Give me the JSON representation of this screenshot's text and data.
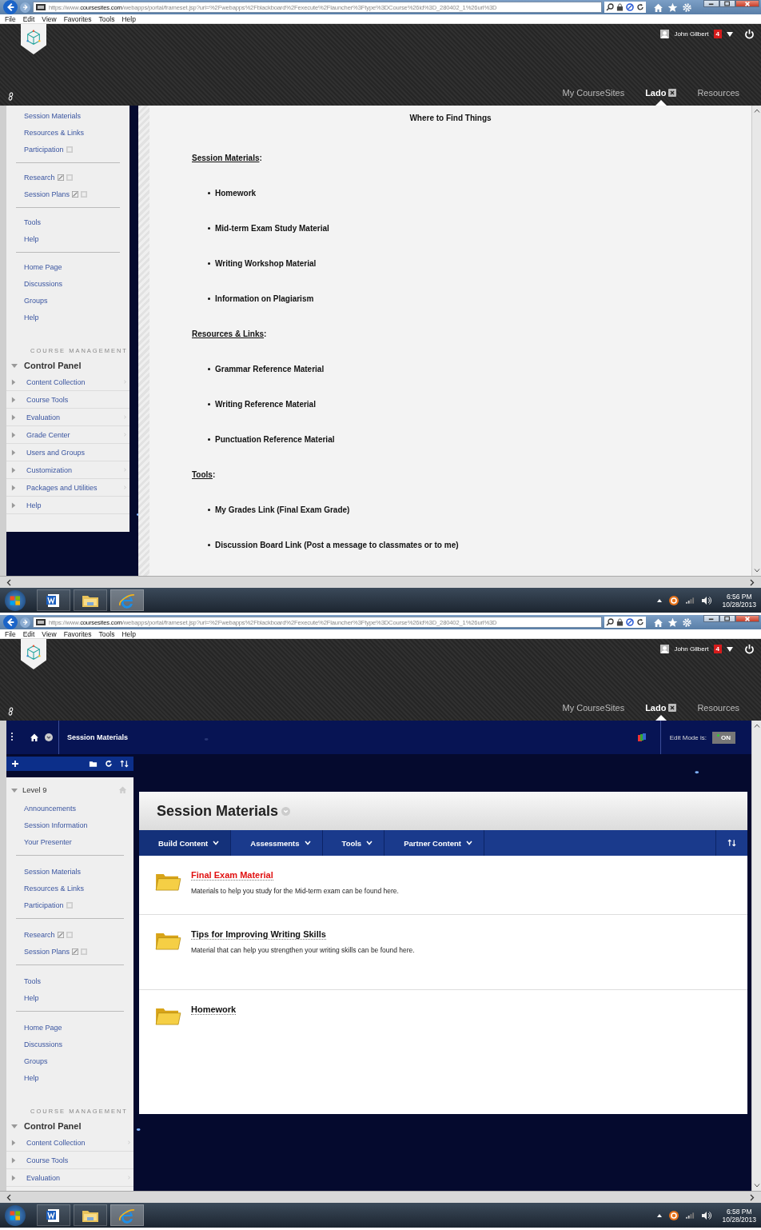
{
  "screens": [
    {
      "kind": "document",
      "browser": {
        "url_scheme": "https://www.",
        "url_domain": "coursesites.com",
        "url_path": "/webapps/portal/frameset.jsp?url=%2Fwebapps%2Fblackboard%2Fexecute%2Flauncher%3Ftype%3DCourse%26id%3D_280402_1%26url%3D",
        "menu": [
          "File",
          "Edit",
          "View",
          "Favorites",
          "Tools",
          "Help"
        ]
      },
      "header": {
        "user": "John Gilbert",
        "notifications": "4",
        "tabs": [
          {
            "label": "My CourseSites",
            "selected": false,
            "closable": false
          },
          {
            "label": "Lado",
            "selected": true,
            "closable": true
          },
          {
            "label": "Resources",
            "selected": false,
            "closable": false
          }
        ]
      },
      "sidebar": {
        "toolbar": false,
        "groups": [
          [
            {
              "label": "Session Materials",
              "external": false,
              "hidden": false
            },
            {
              "label": "Resources & Links",
              "external": false,
              "hidden": false
            },
            {
              "label": "Participation",
              "external": false,
              "hidden": true
            }
          ],
          [
            {
              "label": "Research",
              "external": true,
              "hidden": true
            },
            {
              "label": "Session Plans",
              "external": true,
              "hidden": true
            }
          ],
          [
            {
              "label": "Tools",
              "external": false,
              "hidden": false
            },
            {
              "label": "Help",
              "external": false,
              "hidden": false
            }
          ],
          [
            {
              "label": "Home Page",
              "external": false,
              "hidden": false
            },
            {
              "label": "Discussions",
              "external": false,
              "hidden": false
            },
            {
              "label": "Groups",
              "external": false,
              "hidden": false
            },
            {
              "label": "Help",
              "external": false,
              "hidden": false
            }
          ]
        ],
        "management_label": "COURSE MANAGEMENT",
        "control_panel": {
          "label": "Control Panel",
          "expanded": true,
          "items": [
            {
              "label": "Content Collection",
              "submenu": true
            },
            {
              "label": "Course Tools",
              "submenu": false
            },
            {
              "label": "Evaluation",
              "submenu": true
            },
            {
              "label": "Grade Center",
              "submenu": true
            },
            {
              "label": "Users and Groups",
              "submenu": false
            },
            {
              "label": "Customization",
              "submenu": true
            },
            {
              "label": "Packages and Utilities",
              "submenu": true
            },
            {
              "label": "Help",
              "submenu": false
            }
          ]
        }
      },
      "document": {
        "title": "Where to Find Things",
        "sections": [
          {
            "heading": "Session Materials",
            "punct": ":",
            "items": [
              "Homework",
              "Mid-term Exam Study Material",
              "Writing Workshop Material",
              "Information on Plagiarism"
            ]
          },
          {
            "heading": "Resources & Links",
            "punct": ":",
            "items": [
              "Grammar Reference Material",
              "Writing Reference Material",
              "Punctuation Reference Material"
            ]
          },
          {
            "heading": "Tools",
            "punct": ":",
            "items": [
              "My Grades Link (Final Exam Grade)",
              "Discussion Board Link (Post a message to classmates or to me)"
            ]
          }
        ]
      },
      "taskbar": {
        "apps": [
          {
            "kind": "word",
            "selected": false
          },
          {
            "kind": "explorer",
            "selected": false
          },
          {
            "kind": "ie",
            "selected": true
          }
        ],
        "time": "6:56 PM",
        "date": "10/28/2013"
      }
    },
    {
      "kind": "course_page",
      "browser": {
        "url_scheme": "https://www.",
        "url_domain": "coursesites.com",
        "url_path": "/webapps/portal/frameset.jsp?url=%2Fwebapps%2Fblackboard%2Fexecute%2Flauncher%3Ftype%3DCourse%26id%3D_280402_1%26url%3D",
        "menu": [
          "File",
          "Edit",
          "View",
          "Favorites",
          "Tools",
          "Help"
        ]
      },
      "header": {
        "user": "John Gilbert",
        "notifications": "4",
        "tabs": [
          {
            "label": "My CourseSites",
            "selected": false,
            "closable": false
          },
          {
            "label": "Lado",
            "selected": true,
            "closable": true
          },
          {
            "label": "Resources",
            "selected": false,
            "closable": false
          }
        ]
      },
      "breadcrumb": {
        "label": "Session Materials",
        "edit_mode_label": "Edit Mode is:",
        "edit_mode": {
          "label": "ON",
          "on": true
        }
      },
      "sidebar": {
        "toolbar": true,
        "course": {
          "title": "Level 9",
          "expanded": true
        },
        "groups": [
          [
            {
              "label": "Announcements",
              "external": false,
              "hidden": false
            },
            {
              "label": "Session Information",
              "external": false,
              "hidden": false
            },
            {
              "label": "Your Presenter",
              "external": false,
              "hidden": false
            }
          ],
          [
            {
              "label": "Session Materials",
              "external": false,
              "hidden": false
            },
            {
              "label": "Resources & Links",
              "external": false,
              "hidden": false
            },
            {
              "label": "Participation",
              "external": false,
              "hidden": true
            }
          ],
          [
            {
              "label": "Research",
              "external": true,
              "hidden": true
            },
            {
              "label": "Session Plans",
              "external": true,
              "hidden": true
            }
          ],
          [
            {
              "label": "Tools",
              "external": false,
              "hidden": false
            },
            {
              "label": "Help",
              "external": false,
              "hidden": false
            }
          ],
          [
            {
              "label": "Home Page",
              "external": false,
              "hidden": false
            },
            {
              "label": "Discussions",
              "external": false,
              "hidden": false
            },
            {
              "label": "Groups",
              "external": false,
              "hidden": false
            },
            {
              "label": "Help",
              "external": false,
              "hidden": false
            }
          ]
        ],
        "management_label": "COURSE MANAGEMENT",
        "control_panel": {
          "label": "Control Panel",
          "expanded": true,
          "items": [
            {
              "label": "Content Collection",
              "submenu": true
            },
            {
              "label": "Course Tools",
              "submenu": false
            },
            {
              "label": "Evaluation",
              "submenu": true
            }
          ]
        }
      },
      "content": {
        "title": "Session Materials",
        "actions": [
          "Build Content",
          "Assessments",
          "Tools",
          "Partner Content"
        ],
        "items": [
          {
            "title": "Final Exam Material",
            "highlighted": true,
            "description": "Materials to help you study for the Mid-term exam can be found here."
          },
          {
            "title": "Tips for Improving Writing Skills",
            "highlighted": false,
            "description": "Material that can help you strengthen your writing skills can be found here."
          },
          {
            "title": "Homework",
            "highlighted": false
          }
        ]
      },
      "taskbar": {
        "apps": [
          {
            "kind": "word",
            "selected": false
          },
          {
            "kind": "explorer",
            "selected": false
          },
          {
            "kind": "ie",
            "selected": true
          }
        ],
        "time": "6:58 PM",
        "date": "10/28/2013"
      }
    }
  ]
}
